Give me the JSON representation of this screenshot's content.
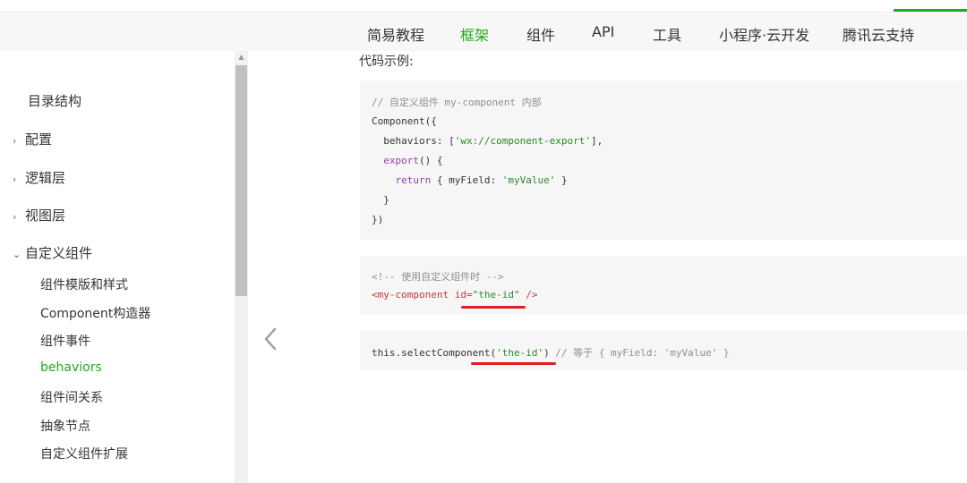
{
  "theme": {
    "accent": "#1aad19",
    "underline_color": "#e02020"
  },
  "nav": {
    "items": [
      {
        "label": "简易教程",
        "active": false
      },
      {
        "label": "框架",
        "active": true
      },
      {
        "label": "组件",
        "active": false
      },
      {
        "label": "API",
        "active": false
      },
      {
        "label": "工具",
        "active": false
      },
      {
        "label": "小程序·云开发",
        "active": false
      },
      {
        "label": "腾讯云支持",
        "active": false
      }
    ]
  },
  "sidebar": {
    "groups": [
      {
        "label": "目录结构",
        "chevron": ""
      },
      {
        "label": "配置",
        "chevron": "›"
      },
      {
        "label": "逻辑层",
        "chevron": "›"
      },
      {
        "label": "视图层",
        "chevron": "›"
      },
      {
        "label": "自定义组件",
        "chevron": "⌄"
      }
    ],
    "sub_items": [
      {
        "label": "组件模版和样式",
        "active": false
      },
      {
        "label": "Component构造器",
        "active": false
      },
      {
        "label": "组件事件",
        "active": false
      },
      {
        "label": "behaviors",
        "active": true
      },
      {
        "label": "组件间关系",
        "active": false
      },
      {
        "label": "抽象节点",
        "active": false
      },
      {
        "label": "自定义组件扩展",
        "active": false
      }
    ]
  },
  "content": {
    "code_title": "代码示例:",
    "block1": {
      "l1": "// 自定义组件 my-component 内部",
      "l2": "Component({",
      "l3_pre": "  behaviors: [",
      "l3_str": "'wx://component-export'",
      "l3_post": "],",
      "l4_kw": "  export",
      "l4_post": "() {",
      "l5_kw": "    return",
      "l5_mid": " { myField: ",
      "l5_str": "'myValue'",
      "l5_post": " }",
      "l6": "  }",
      "l7": "})"
    },
    "block2": {
      "l1": "<!-- 使用自定义组件时 -->",
      "l2_tag": "<my-component",
      "l2_attr": " id=",
      "l2_val": "\"the-id\"",
      "l2_close": " />"
    },
    "block3": {
      "pre": "this.selectComponent(",
      "str": "'the-id'",
      "post": ")",
      "comment": " // 等于 { myField: 'myValue' }"
    }
  },
  "icons": {
    "prev": "chevron-left-icon",
    "scroll_up": "triangle-up-icon"
  }
}
